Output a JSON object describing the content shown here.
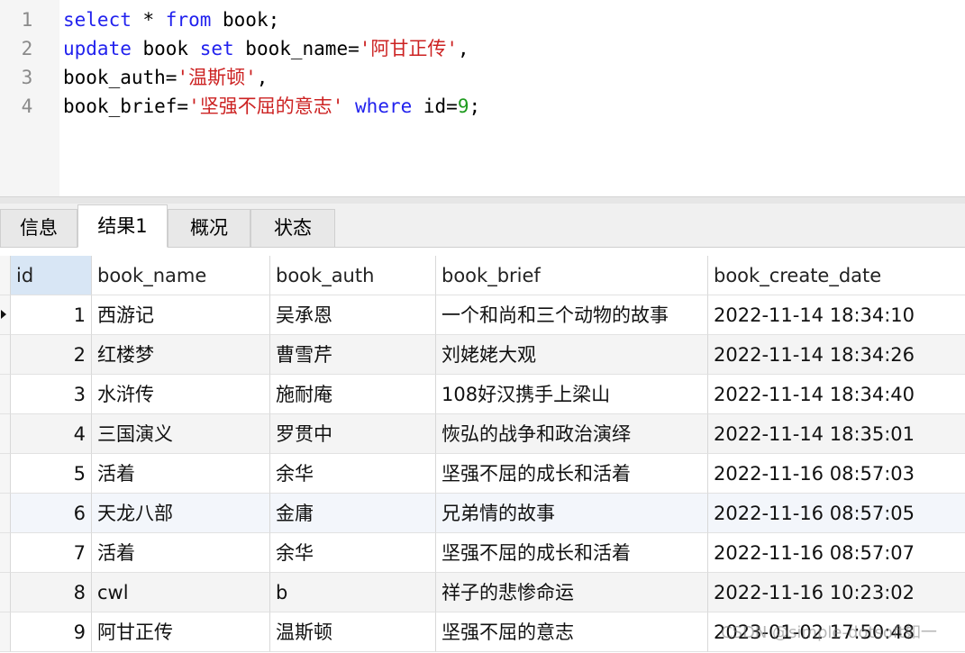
{
  "editor": {
    "lines": [
      {
        "num": "1",
        "tokens": [
          [
            "kw",
            "select"
          ],
          [
            "op",
            " * "
          ],
          [
            "kw",
            "from"
          ],
          [
            "op",
            " book;"
          ]
        ]
      },
      {
        "num": "2",
        "tokens": [
          [
            "kw",
            "update"
          ],
          [
            "op",
            " book "
          ],
          [
            "kw",
            "set"
          ],
          [
            "op",
            " book_name="
          ],
          [
            "str",
            "'阿甘正传'"
          ],
          [
            "op",
            ","
          ]
        ]
      },
      {
        "num": "3",
        "tokens": [
          [
            "op",
            "book_auth="
          ],
          [
            "str",
            "'温斯顿'"
          ],
          [
            "op",
            ","
          ]
        ]
      },
      {
        "num": "4",
        "tokens": [
          [
            "op",
            "book_brief="
          ],
          [
            "str",
            "'坚强不屈的意志'"
          ],
          [
            "op",
            " "
          ],
          [
            "kw",
            "where"
          ],
          [
            "op",
            " id="
          ],
          [
            "num",
            "9"
          ],
          [
            "op",
            ";"
          ]
        ]
      }
    ]
  },
  "tabs": [
    {
      "label": "信息",
      "active": false
    },
    {
      "label": "结果1",
      "active": true
    },
    {
      "label": "概况",
      "active": false
    },
    {
      "label": "状态",
      "active": false
    }
  ],
  "grid": {
    "columns": [
      "id",
      "book_name",
      "book_auth",
      "book_brief",
      "book_create_date"
    ],
    "rows": [
      {
        "id": "1",
        "book_name": "西游记",
        "book_auth": "吴承恩",
        "book_brief": "一个和尚和三个动物的故事",
        "book_create_date": "2022-11-14 18:34:10"
      },
      {
        "id": "2",
        "book_name": "红楼梦",
        "book_auth": "曹雪芹",
        "book_brief": "刘姥姥大观",
        "book_create_date": "2022-11-14 18:34:26"
      },
      {
        "id": "3",
        "book_name": "水浒传",
        "book_auth": "施耐庵",
        "book_brief": "108好汉携手上梁山",
        "book_create_date": "2022-11-14 18:34:40"
      },
      {
        "id": "4",
        "book_name": "三国演义",
        "book_auth": "罗贯中",
        "book_brief": "恢弘的战争和政治演绎",
        "book_create_date": "2022-11-14 18:35:01"
      },
      {
        "id": "5",
        "book_name": "活着",
        "book_auth": "余华",
        "book_brief": "坚强不屈的成长和活着",
        "book_create_date": "2022-11-16 08:57:03"
      },
      {
        "id": "6",
        "book_name": "天龙八部",
        "book_auth": "金庸",
        "book_brief": "兄弟情的故事",
        "book_create_date": "2022-11-16 08:57:05"
      },
      {
        "id": "7",
        "book_name": "活着",
        "book_auth": "余华",
        "book_brief": "坚强不屈的成长和活着",
        "book_create_date": "2022-11-16 08:57:07"
      },
      {
        "id": "8",
        "book_name": "cwl",
        "book_auth": "b",
        "book_brief": "祥子的悲惨命运",
        "book_create_date": "2022-11-16 10:23:02"
      },
      {
        "id": "9",
        "book_name": "阿甘正传",
        "book_auth": "温斯顿",
        "book_brief": "坚强不屈的意志",
        "book_create_date": "2023-01-02 17:50:48"
      }
    ]
  },
  "watermark": "CSDN @simple-dotsoft如一"
}
